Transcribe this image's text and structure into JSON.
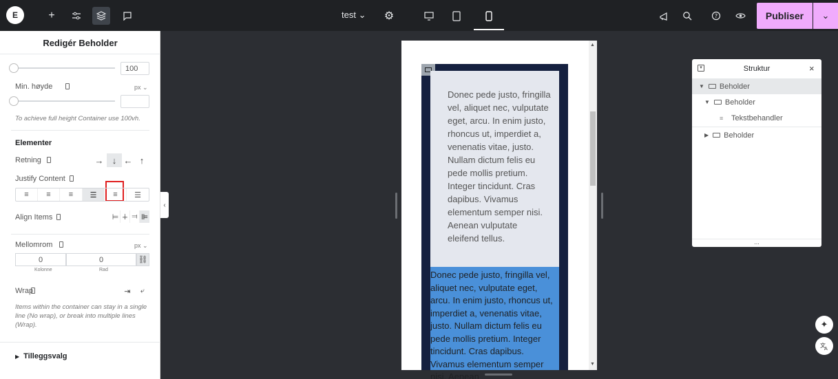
{
  "topbar": {
    "logo": "E",
    "doc_name": "test",
    "doc_caret": "⌄",
    "add_icon": "+",
    "settings_icon": "⚙",
    "publish_label": "Publiser",
    "publish_caret": "⌄"
  },
  "panel": {
    "title": "Redigér Beholder",
    "width_value": "100",
    "min_height_label": "Min. høyde",
    "min_height_unit": "px ⌄",
    "min_height_value": "",
    "min_height_note": "To achieve full height Container use 100vh.",
    "section_elements": "Elementer",
    "direction_label": "Retning",
    "direction_options": [
      "→",
      "↓",
      "←",
      "↑"
    ],
    "justify_label": "Justify Content",
    "align_label": "Align Items",
    "gap_label": "Mellomrom",
    "gap_unit": "px ⌄",
    "gap_column_value": "0",
    "gap_row_value": "0",
    "gap_column_label": "Kolonne",
    "gap_row_label": "Rad",
    "wrap_label": "Wrap",
    "wrap_note": "Items within the container can stay in a single line (No wrap), or break into multiple lines (Wrap).",
    "additional_label": "Tilleggsvalg"
  },
  "canvas": {
    "inner_text": "Donec pede justo, fringilla vel, aliquet nec, vulputate eget, arcu. In enim justo, rhoncus ut, imperdiet a, venenatis vitae, justo. Nullam dictum felis eu pede mollis pretium. Integer tincidunt. Cras dapibus. Vivamus elementum semper nisi. Aenean vulputate eleifend tellus.",
    "blue_text": "Donec pede justo, fringilla vel, aliquet nec, vulputate eget, arcu. In enim justo, rhoncus ut, imperdiet a, venenatis vitae, justo. Nullam dictum felis eu pede mollis pretium. Integer tincidunt. Cras dapibus. Vivamus elementum semper nisi. Aenean"
  },
  "structure": {
    "title": "Struktur",
    "close": "×",
    "items": [
      "Beholder",
      "Beholder",
      "Tekstbehandler",
      "Beholder"
    ],
    "footer": "..."
  },
  "colors": {
    "topbar": "#1f2124",
    "publish": "#f0abfc",
    "canvas_bg": "#2c2e33",
    "outer_container": "#15203f",
    "highlight_blue": "#4a90d9"
  }
}
